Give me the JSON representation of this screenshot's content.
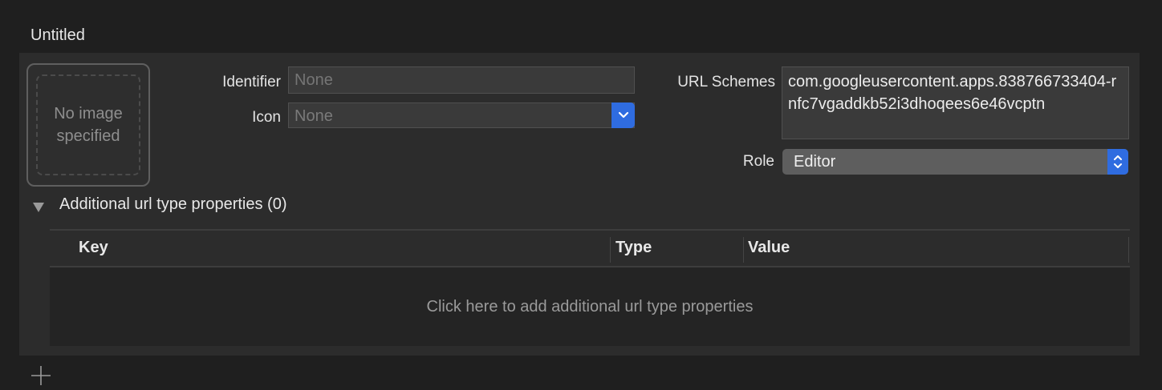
{
  "section": {
    "title": "Untitled"
  },
  "image_well": {
    "placeholder": "No image specified"
  },
  "identifier": {
    "label": "Identifier",
    "value": "",
    "placeholder": "None"
  },
  "icon": {
    "label": "Icon",
    "value": "None"
  },
  "url_schemes": {
    "label": "URL Schemes",
    "value": "com.googleusercontent.apps.838766733404-rnfc7vgaddkb52i3dhoqees6e46vcptn"
  },
  "role": {
    "label": "Role",
    "value": "Editor"
  },
  "additional": {
    "title": "Additional url type properties (0)",
    "columns": {
      "key": "Key",
      "type": "Type",
      "value": "Value"
    },
    "empty_message": "Click here to add additional url type properties"
  },
  "colors": {
    "accent": "#2f6ce0",
    "background": "#1f1f1f",
    "panel": "#2c2c2c"
  },
  "icons": {
    "disclosure": "triangle-down-icon",
    "add": "plus-icon",
    "popup": "chevron-down-icon",
    "stepper": "up-down-chevron-icon"
  }
}
